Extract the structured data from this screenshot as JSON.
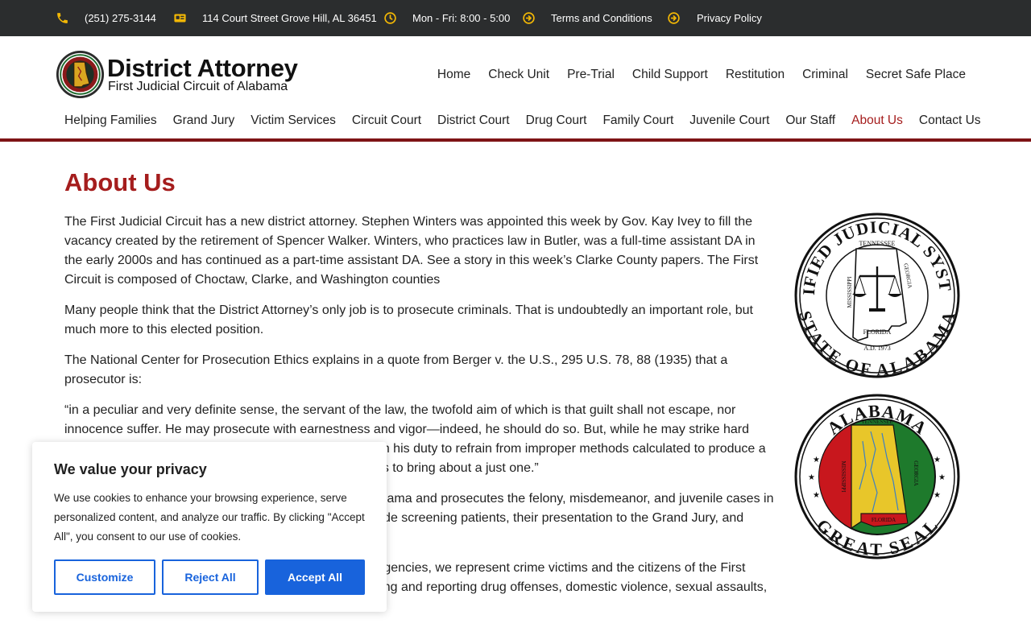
{
  "topbar": {
    "phone": "(251) 275-3144",
    "address": "114 Court Street Grove Hill, AL 36451",
    "hours": "Mon - Fri: 8:00 - 5:00",
    "terms": "Terms and Conditions",
    "privacy": "Privacy Policy",
    "icon_color": "#f2b705",
    "icons": [
      "phone-icon",
      "address-card-icon",
      "clock-icon",
      "arrow-circle-right-icon",
      "arrow-circle-right-icon"
    ]
  },
  "logo": {
    "title": "District Attorney",
    "subtitle": "First Judicial Circuit of Alabama"
  },
  "nav_primary": [
    "Home",
    "Check Unit",
    "Pre-Trial",
    "Child Support",
    "Restitution",
    "Criminal",
    "Secret Safe Place"
  ],
  "nav_secondary": [
    "Helping Families",
    "Grand Jury",
    "Victim Services",
    "Circuit Court",
    "District Court",
    "Drug Court",
    "Family Court",
    "Juvenile Court",
    "Our Staff",
    "About Us",
    "Contact Us"
  ],
  "nav_active": "About Us",
  "page": {
    "title": "About Us",
    "paragraphs": [
      "The First Judicial Circuit has a new district attorney. Stephen Winters was appointed this week by Gov. Kay Ivey to fill the vacancy created by the retirement of Spencer Walker. Winters, who practices law in Butler, was a full-time assistant DA in the early 2000s and has continued as a part-time assistant DA. See a story in this week’s Clarke County papers. The First Circuit is composed of Choctaw, Clarke, and Washington counties",
      "Many people think that the District Attorney’s only job is to prosecute criminals. That is undoubtedly an important role, but much more to this elected position.",
      "The National Center for Prosecution Ethics explains in a quote from Berger v. the U.S., 295 U.S. 78, 88 (1935) that a prosecutor is:",
      "“in a peculiar and very definite sense, the servant of the law, the twofold aim of which is that guilt shall not escape, nor innocence suffer. He may prosecute with earnestness and vigor—indeed, he should do so. But, while he may strike hard blows, he is not at liberty to strike foul ones. It is as much his duty to refrain from improper methods calculated to produce a wrongful conviction as it is to use every legitimate means to bring about a just one.”",
      "The District Attorney’s Office represents the state of Alabama and prosecutes the felony, misdemeanor, and juvenile cases in Choctaw, Clarke, and Washington counties. Duties include screening patients, their presentation to the Grand Jury, and presentation of evidence in Circuit and District Courts.",
      "Working with local, state, and federal law enforcement agencies, we represent crime victims and the citizens of the First Judicial Circuit while taking a proactive stand in preventing and reporting drug offenses, domestic violence, sexual assaults, and child abuse."
    ]
  },
  "seals": {
    "seal1": {
      "ring_top": "UNIFIED JUDICIAL SYSTEM",
      "ring_bottom": "STATE OF ALABAMA",
      "north": "TENNESSEE",
      "west": "MISSISSIPPI",
      "east": "GEORGIA",
      "south": "FLORIDA",
      "year": "A.D. 1973"
    },
    "seal2": {
      "ring_top": "ALABAMA",
      "ring_bottom": "GREAT SEAL",
      "north": "TENNESSEE",
      "west": "MISSISSIPPI",
      "east": "GEORGIA",
      "south": "FLORIDA"
    }
  },
  "cookie": {
    "title": "We value your privacy",
    "text": "We use cookies to enhance your browsing experience, serve personalized content, and analyze our traffic. By clicking \"Accept All\", you consent to our use of cookies.",
    "customize": "Customize",
    "reject": "Reject All",
    "accept": "Accept All",
    "accent": "#1863dc"
  }
}
